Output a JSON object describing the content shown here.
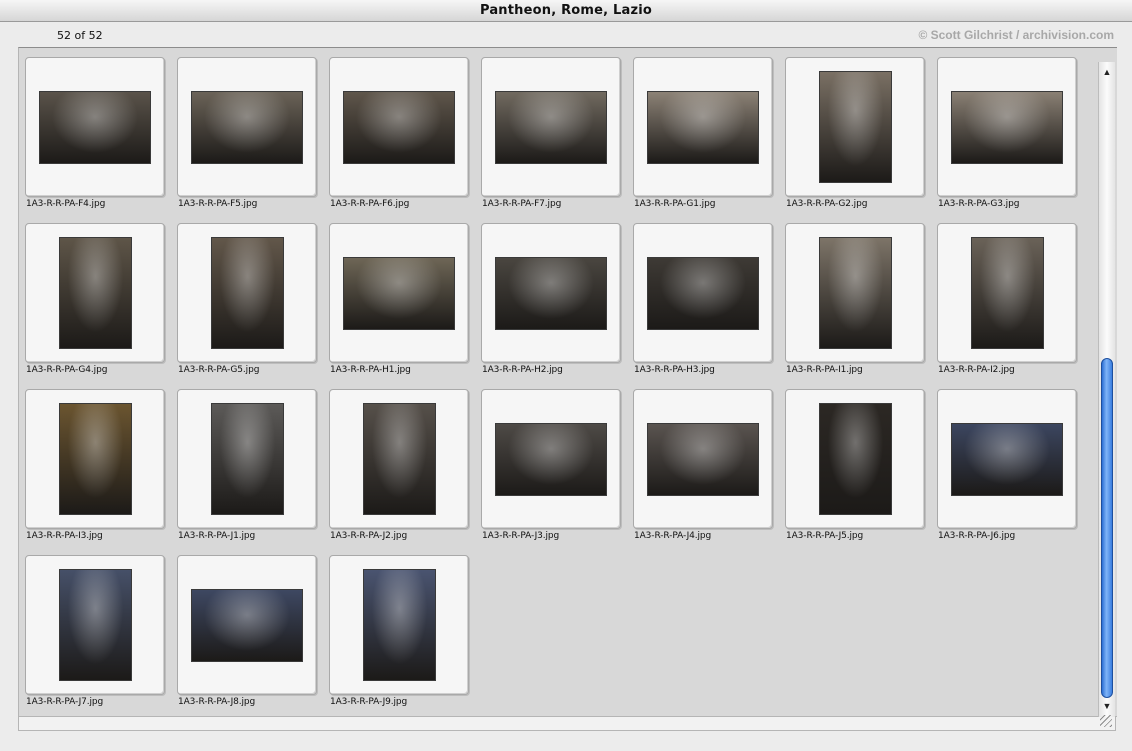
{
  "window": {
    "title": "Pantheon, Rome, Lazio"
  },
  "toolbar": {
    "count": "52 of 52",
    "credit": "© Scott Gilchrist / archivision.com"
  },
  "scroll": {
    "position_fraction": 1.0
  },
  "thumbnails": [
    {
      "file": "1A3-R-R-PA-F4.jpg",
      "orient": "land",
      "tone": "#5a534a"
    },
    {
      "file": "1A3-R-R-PA-F5.jpg",
      "orient": "land",
      "tone": "#6b6358"
    },
    {
      "file": "1A3-R-R-PA-F6.jpg",
      "orient": "land",
      "tone": "#5f564b"
    },
    {
      "file": "1A3-R-R-PA-F7.jpg",
      "orient": "land",
      "tone": "#716a60"
    },
    {
      "file": "1A3-R-R-PA-G1.jpg",
      "orient": "land",
      "tone": "#8c8276"
    },
    {
      "file": "1A3-R-R-PA-G2.jpg",
      "orient": "port",
      "tone": "#7a7064"
    },
    {
      "file": "1A3-R-R-PA-G3.jpg",
      "orient": "land",
      "tone": "#8a8074"
    },
    {
      "file": "1A3-R-R-PA-G4.jpg",
      "orient": "port",
      "tone": "#5e5548"
    },
    {
      "file": "1A3-R-R-PA-G5.jpg",
      "orient": "port",
      "tone": "#62574a"
    },
    {
      "file": "1A3-R-R-PA-H1.jpg",
      "orient": "land",
      "tone": "#6e6656"
    },
    {
      "file": "1A3-R-R-PA-H2.jpg",
      "orient": "land",
      "tone": "#4a4640"
    },
    {
      "file": "1A3-R-R-PA-H3.jpg",
      "orient": "land",
      "tone": "#3e3a35"
    },
    {
      "file": "1A3-R-R-PA-I1.jpg",
      "orient": "port",
      "tone": "#7d7468"
    },
    {
      "file": "1A3-R-R-PA-I2.jpg",
      "orient": "port",
      "tone": "#6a6258"
    },
    {
      "file": "1A3-R-R-PA-I3.jpg",
      "orient": "port",
      "tone": "#6b5530"
    },
    {
      "file": "1A3-R-R-PA-J1.jpg",
      "orient": "port",
      "tone": "#5c5a58"
    },
    {
      "file": "1A3-R-R-PA-J2.jpg",
      "orient": "port",
      "tone": "#56504a"
    },
    {
      "file": "1A3-R-R-PA-J3.jpg",
      "orient": "land",
      "tone": "#4e4a46"
    },
    {
      "file": "1A3-R-R-PA-J4.jpg",
      "orient": "land",
      "tone": "#5a5450"
    },
    {
      "file": "1A3-R-R-PA-J5.jpg",
      "orient": "port",
      "tone": "#2c2824"
    },
    {
      "file": "1A3-R-R-PA-J6.jpg",
      "orient": "land",
      "tone": "#3c4660"
    },
    {
      "file": "1A3-R-R-PA-J7.jpg",
      "orient": "port",
      "tone": "#465068"
    },
    {
      "file": "1A3-R-R-PA-J8.jpg",
      "orient": "land",
      "tone": "#3e4862"
    },
    {
      "file": "1A3-R-R-PA-J9.jpg",
      "orient": "port",
      "tone": "#4a5470"
    }
  ]
}
